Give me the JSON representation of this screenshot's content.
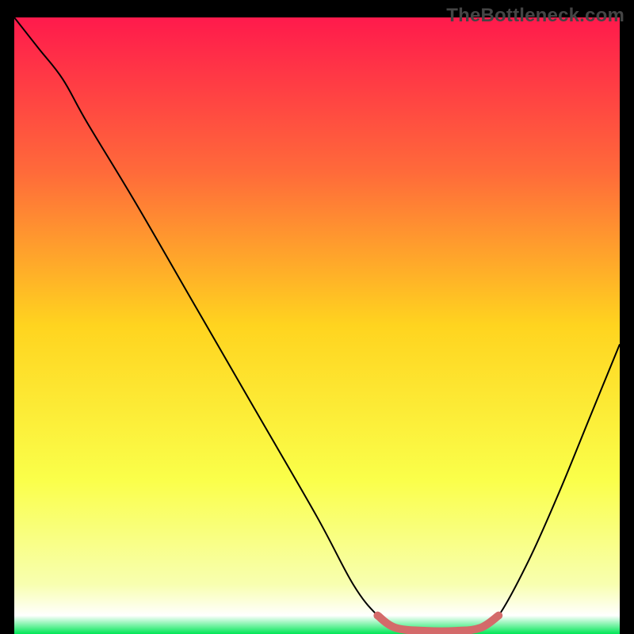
{
  "watermark": "TheBottleneck.com",
  "chart_data": {
    "type": "line",
    "title": "",
    "xlabel": "",
    "ylabel": "",
    "xlim": [
      0,
      100
    ],
    "ylim": [
      0,
      100
    ],
    "background_gradient": {
      "stops": [
        {
          "offset": 0,
          "color": "#ff1a4c"
        },
        {
          "offset": 25,
          "color": "#ff6a3a"
        },
        {
          "offset": 50,
          "color": "#ffd41f"
        },
        {
          "offset": 75,
          "color": "#faff4a"
        },
        {
          "offset": 92,
          "color": "#f8ffb0"
        },
        {
          "offset": 97,
          "color": "#ffffff"
        },
        {
          "offset": 100,
          "color": "#00e756"
        }
      ]
    },
    "series": [
      {
        "name": "curve",
        "color": "#000000",
        "width": 2,
        "points": [
          {
            "x": 0,
            "y": 100
          },
          {
            "x": 4,
            "y": 95
          },
          {
            "x": 8,
            "y": 90
          },
          {
            "x": 12,
            "y": 83
          },
          {
            "x": 20,
            "y": 70
          },
          {
            "x": 30,
            "y": 53
          },
          {
            "x": 40,
            "y": 36
          },
          {
            "x": 50,
            "y": 19
          },
          {
            "x": 56,
            "y": 8
          },
          {
            "x": 60,
            "y": 3
          },
          {
            "x": 63,
            "y": 1
          },
          {
            "x": 68,
            "y": 0.5
          },
          {
            "x": 73,
            "y": 0.5
          },
          {
            "x": 77,
            "y": 1
          },
          {
            "x": 80,
            "y": 3
          },
          {
            "x": 85,
            "y": 12
          },
          {
            "x": 90,
            "y": 23
          },
          {
            "x": 95,
            "y": 35
          },
          {
            "x": 100,
            "y": 47
          }
        ]
      },
      {
        "name": "highlight",
        "color": "#d46a6a",
        "width": 10,
        "points": [
          {
            "x": 60,
            "y": 3
          },
          {
            "x": 63,
            "y": 1
          },
          {
            "x": 68,
            "y": 0.5
          },
          {
            "x": 73,
            "y": 0.5
          },
          {
            "x": 77,
            "y": 1
          },
          {
            "x": 80,
            "y": 3
          }
        ]
      }
    ]
  }
}
